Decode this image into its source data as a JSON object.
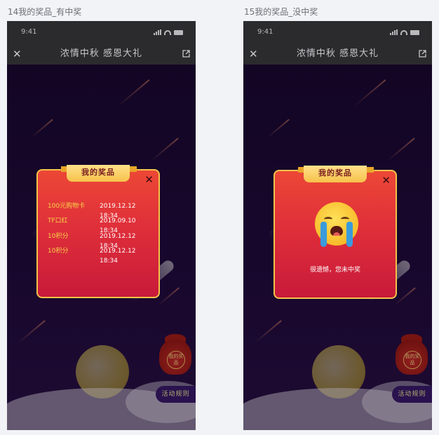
{
  "screens": [
    {
      "label": "14我的奖品_有中奖",
      "status_time": "9:41",
      "nav": {
        "close_glyph": "✕",
        "title": "浓情中秋  感恩大礼",
        "share_icon": "share-icon"
      },
      "modal": {
        "title": "我的奖品",
        "close_glyph": "✕",
        "prizes": [
          {
            "name": "100元购物卡",
            "date": "2019.12.12 18:34"
          },
          {
            "name": "TF口红",
            "date": "2019.09.10 18:34"
          },
          {
            "name": "10积分",
            "date": "2019.12.12 18:34"
          },
          {
            "name": "10积分",
            "date": "2019.12.12 18:34"
          }
        ]
      },
      "bag_label": "我的奖品",
      "rules_button": "活动规则"
    },
    {
      "label": "15我的奖品_没中奖",
      "status_time": "9:41",
      "nav": {
        "close_glyph": "✕",
        "title": "浓情中秋  感恩大礼",
        "share_icon": "share-icon"
      },
      "modal": {
        "title": "我的奖品",
        "close_glyph": "✕",
        "empty_icon": "crying-face-icon",
        "message": "很遗憾，您未中奖"
      },
      "bag_label": "我的奖品",
      "rules_button": "活动规则"
    }
  ],
  "colors": {
    "background": "#f2f3f6",
    "modal_border": "#f3c34a",
    "prize_name": "#f7d24a",
    "modal_red": "#df2f3a"
  }
}
